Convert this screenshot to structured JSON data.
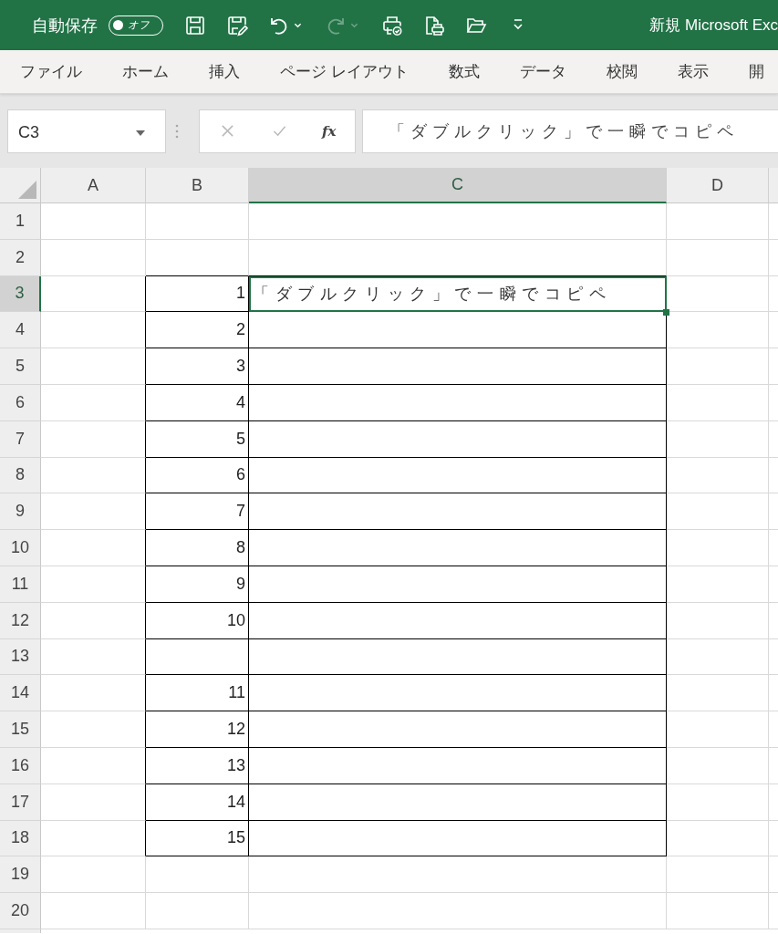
{
  "title_bar": {
    "autosave": {
      "label": "自動保存",
      "on": false,
      "state_text": "オフ"
    },
    "quick_access": [
      {
        "kind": "save",
        "dropdown": false,
        "disabled": false
      },
      {
        "kind": "save_edit",
        "dropdown": false,
        "disabled": false
      },
      {
        "kind": "undo",
        "dropdown": true,
        "disabled": false
      },
      {
        "kind": "redo",
        "dropdown": true,
        "disabled": true
      },
      {
        "kind": "print_check",
        "dropdown": false,
        "disabled": false
      },
      {
        "kind": "print_doc",
        "dropdown": false,
        "disabled": false
      },
      {
        "kind": "open",
        "dropdown": false,
        "disabled": false
      },
      {
        "kind": "customize",
        "dropdown": false,
        "disabled": false
      }
    ],
    "title": "新規 Microsoft Exc"
  },
  "ribbon_tabs": [
    {
      "label": "ファイル"
    },
    {
      "label": "ホーム"
    },
    {
      "label": "挿入"
    },
    {
      "label": "ページ レイアウト"
    },
    {
      "label": "数式"
    },
    {
      "label": "データ"
    },
    {
      "label": "校閲"
    },
    {
      "label": "表示"
    },
    {
      "label": "開"
    }
  ],
  "formula_bar": {
    "name_box": {
      "value": "C3"
    },
    "edit_buttons": [
      {
        "kind": "cancel",
        "disabled": true
      },
      {
        "kind": "enter",
        "disabled": true
      }
    ],
    "function_button": "fx",
    "formula": {
      "value": "「ダブルクリック」で一瞬でコピペ"
    }
  },
  "sheet": {
    "columns": [
      {
        "label": "A",
        "selected": false
      },
      {
        "label": "B",
        "selected": false
      },
      {
        "label": "C",
        "selected": true
      },
      {
        "label": "D",
        "selected": false
      }
    ],
    "rows": [
      {
        "header": "1",
        "selected": false,
        "bordered": false
      },
      {
        "header": "2",
        "selected": false,
        "bordered": false
      },
      {
        "header": "3",
        "selected": true,
        "bordered": true,
        "cell_b": "1",
        "cell_c": "「ダブルクリック」で一瞬でコピペ"
      },
      {
        "header": "4",
        "selected": false,
        "bordered": true,
        "cell_b": "2"
      },
      {
        "header": "5",
        "selected": false,
        "bordered": true,
        "cell_b": "3"
      },
      {
        "header": "6",
        "selected": false,
        "bordered": true,
        "cell_b": "4"
      },
      {
        "header": "7",
        "selected": false,
        "bordered": true,
        "cell_b": "5"
      },
      {
        "header": "8",
        "selected": false,
        "bordered": true,
        "cell_b": "6"
      },
      {
        "header": "9",
        "selected": false,
        "bordered": true,
        "cell_b": "7"
      },
      {
        "header": "10",
        "selected": false,
        "bordered": true,
        "cell_b": "8"
      },
      {
        "header": "11",
        "selected": false,
        "bordered": true,
        "cell_b": "9"
      },
      {
        "header": "12",
        "selected": false,
        "bordered": true,
        "cell_b": "10"
      },
      {
        "header": "13",
        "selected": false,
        "bordered": true
      },
      {
        "header": "14",
        "selected": false,
        "bordered": true,
        "cell_b": "11"
      },
      {
        "header": "15",
        "selected": false,
        "bordered": true,
        "cell_b": "12"
      },
      {
        "header": "16",
        "selected": false,
        "bordered": true,
        "cell_b": "13"
      },
      {
        "header": "17",
        "selected": false,
        "bordered": true,
        "cell_b": "14"
      },
      {
        "header": "18",
        "selected": false,
        "bordered": true,
        "cell_b": "15"
      },
      {
        "header": "19",
        "selected": false,
        "bordered": false
      },
      {
        "header": "20",
        "selected": false,
        "bordered": false
      }
    ]
  }
}
